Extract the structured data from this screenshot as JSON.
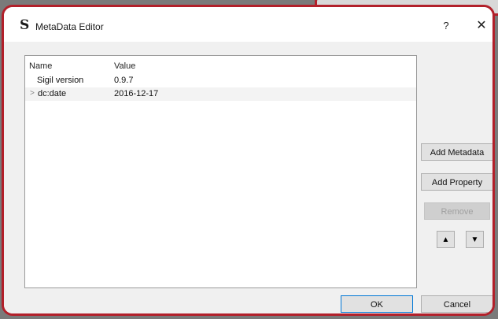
{
  "dialog": {
    "title": "MetaData Editor",
    "help_label": "?",
    "close_label": "✕"
  },
  "tree": {
    "columns": [
      "Name",
      "Value"
    ],
    "rows": [
      {
        "name": "Sigil version",
        "value": "0.9.7",
        "expandable": false
      },
      {
        "name": "dc:date",
        "value": "2016-12-17",
        "expandable": true
      }
    ]
  },
  "buttons": {
    "add_metadata": "Add Metadata",
    "add_property": "Add Property",
    "remove": "Remove",
    "ok": "OK",
    "cancel": "Cancel"
  },
  "icons": {
    "app": "sigil-icon",
    "move_up": "arrow-up-icon",
    "move_down": "arrow-down-icon"
  }
}
